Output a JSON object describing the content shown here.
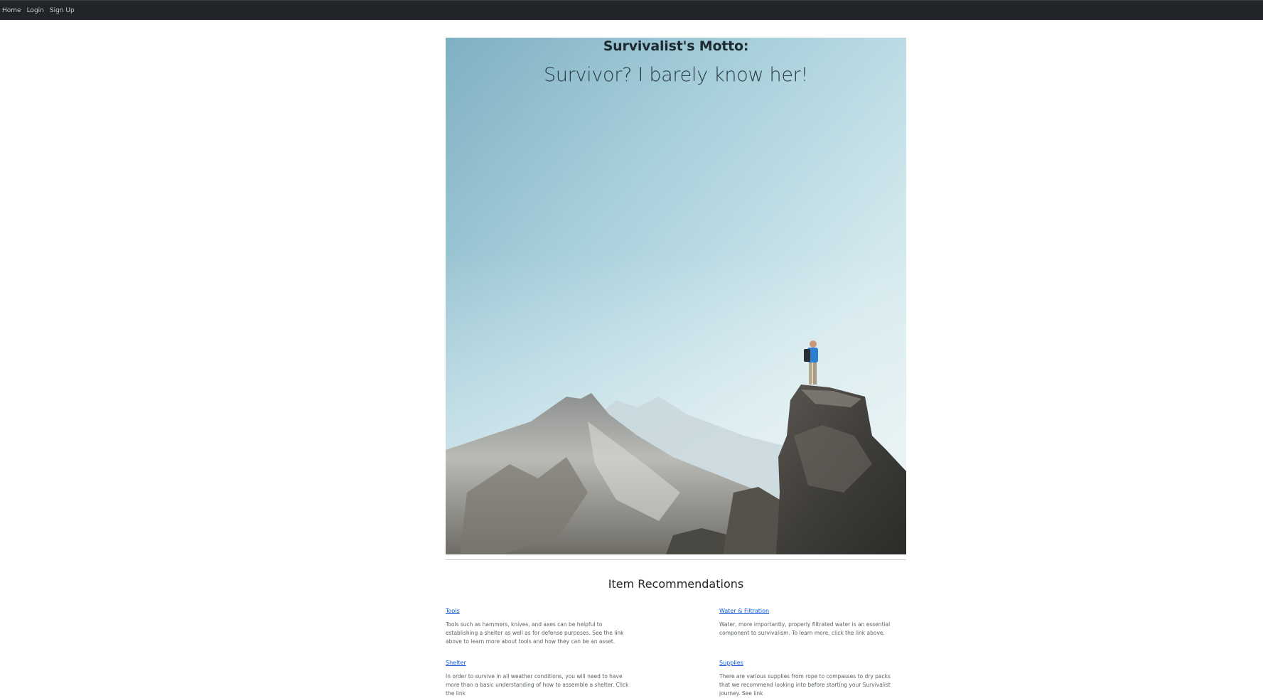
{
  "nav": {
    "items": [
      {
        "label": "Home"
      },
      {
        "label": "Login"
      },
      {
        "label": "Sign Up"
      }
    ]
  },
  "hero": {
    "heading": "Survivalist's Motto:",
    "motto": "Survivor? I barely know her!",
    "image": "hiker standing on a rocky summit overlooking snowy mountains under a pale blue sky"
  },
  "recommendations": {
    "title": "Item Recommendations",
    "items": [
      {
        "link": "Tools",
        "text": "Tools such as hammers, knives, and axes can be helpful to establishing a shelter as well as for defense purposes. See the link above to learn more about tools and how they can be an asset."
      },
      {
        "link": "Water & Filtration",
        "text": "Water, more importantly, properly filtrated water is an essential component to survivalism. To learn more, click the link above."
      },
      {
        "link": "Shelter",
        "text": "In order to survive in all weather conditions, you will need to have more than a basic understanding of how to assemble a shelter. Click the link"
      },
      {
        "link": "Supplies",
        "text": "There are various supplies from rope to compasses to dry packs that we recommend looking into before starting your Survivalist journey. See link"
      }
    ]
  }
}
